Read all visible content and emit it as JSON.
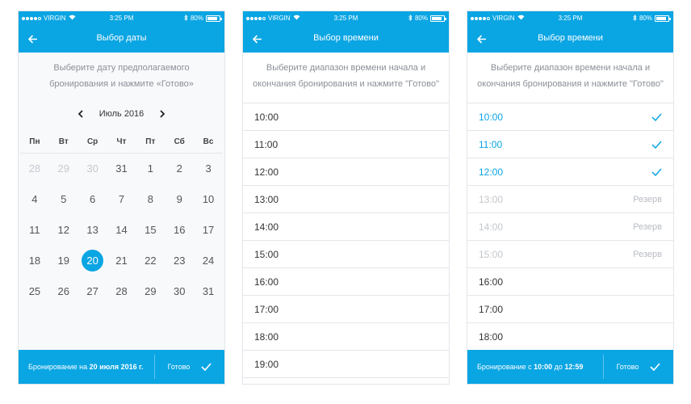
{
  "colors": {
    "accent": "#0aa5e3",
    "muted_text": "#8a8f96",
    "disabled_text": "#c5c9ce"
  },
  "status_bar": {
    "carrier": "VIRGIN",
    "time": "3:25 PM",
    "battery": "80%"
  },
  "screen_date": {
    "title": "Выбор даты",
    "instruction": "Выберите дату предполагаемого бронирования и нажмите «Готово»",
    "month": "Июль 2016",
    "weekdays": [
      "Пн",
      "Вт",
      "Ср",
      "Чт",
      "Пт",
      "Сб",
      "Вс"
    ],
    "days": [
      {
        "d": "28",
        "muted": true
      },
      {
        "d": "29",
        "muted": true
      },
      {
        "d": "30",
        "muted": true
      },
      {
        "d": "31"
      },
      {
        "d": "1"
      },
      {
        "d": "2"
      },
      {
        "d": "3"
      },
      {
        "d": "4"
      },
      {
        "d": "5"
      },
      {
        "d": "6"
      },
      {
        "d": "7"
      },
      {
        "d": "8"
      },
      {
        "d": "9"
      },
      {
        "d": "10"
      },
      {
        "d": "11"
      },
      {
        "d": "12"
      },
      {
        "d": "13"
      },
      {
        "d": "14"
      },
      {
        "d": "15"
      },
      {
        "d": "16"
      },
      {
        "d": "17"
      },
      {
        "d": "18"
      },
      {
        "d": "19"
      },
      {
        "d": "20",
        "selected": true
      },
      {
        "d": "21"
      },
      {
        "d": "22"
      },
      {
        "d": "23"
      },
      {
        "d": "24"
      },
      {
        "d": "25"
      },
      {
        "d": "26"
      },
      {
        "d": "27"
      },
      {
        "d": "28"
      },
      {
        "d": "29"
      },
      {
        "d": "30"
      },
      {
        "d": "31"
      }
    ],
    "bottom_prefix": "Бронирование на ",
    "bottom_date": "20 июля 2016 г.",
    "done_label": "Готово"
  },
  "screen_time": {
    "title": "Выбор времени",
    "instruction": "Выберите диапазон времени начала и окончания бронирования и нажмите \"Готово\"",
    "slots": [
      "10:00",
      "11:00",
      "12:00",
      "13:00",
      "14:00",
      "15:00",
      "16:00",
      "17:00",
      "18:00",
      "19:00"
    ]
  },
  "screen_time2": {
    "title": "Выбор времени",
    "instruction": "Выберите диапазон времени начала и окончания бронирования и нажмите \"Готово\"",
    "slots": [
      {
        "time": "10:00",
        "state": "selected"
      },
      {
        "time": "11:00",
        "state": "selected"
      },
      {
        "time": "12:00",
        "state": "selected"
      },
      {
        "time": "13:00",
        "state": "reserved",
        "label": "Резерв"
      },
      {
        "time": "14:00",
        "state": "reserved",
        "label": "Резерв"
      },
      {
        "time": "15:00",
        "state": "reserved",
        "label": "Резерв"
      },
      {
        "time": "16:00",
        "state": "free"
      },
      {
        "time": "17:00",
        "state": "free"
      },
      {
        "time": "18:00",
        "state": "free"
      }
    ],
    "bottom_prefix": "Бронирование с ",
    "bottom_from": "10:00",
    "bottom_mid": " до ",
    "bottom_to": "12:59",
    "done_label": "Готово"
  }
}
